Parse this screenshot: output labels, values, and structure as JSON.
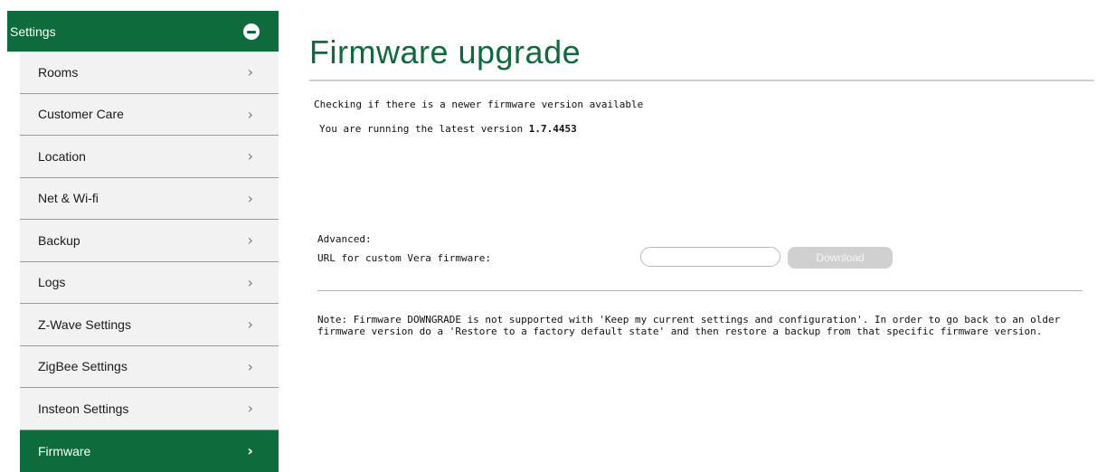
{
  "sidebar": {
    "header_label": "Settings",
    "header_icon": "minus-circle-icon",
    "items": [
      {
        "label": "Rooms"
      },
      {
        "label": "Customer Care"
      },
      {
        "label": "Location"
      },
      {
        "label": "Net & Wi-fi"
      },
      {
        "label": "Backup"
      },
      {
        "label": "Logs"
      },
      {
        "label": "Z-Wave Settings"
      },
      {
        "label": "ZigBee Settings"
      },
      {
        "label": "Insteon Settings"
      },
      {
        "label": "Firmware"
      }
    ],
    "active_item": "Firmware",
    "accent_color": "#0e6b3c"
  },
  "main": {
    "title": "Firmware upgrade",
    "checking_text": "Checking if there is a newer firmware version available",
    "version_prefix": "You are running the latest version ",
    "version": "1.7.4453",
    "advanced_label": "Advanced:",
    "url_label": "URL for custom Vera firmware:",
    "url_value": "",
    "download_label": "Download",
    "note": "Note: Firmware DOWNGRADE is not supported with 'Keep my current settings and configuration'. In order to go back to an older firmware version do a 'Restore to a factory default state' and then restore a backup from that specific firmware version."
  }
}
